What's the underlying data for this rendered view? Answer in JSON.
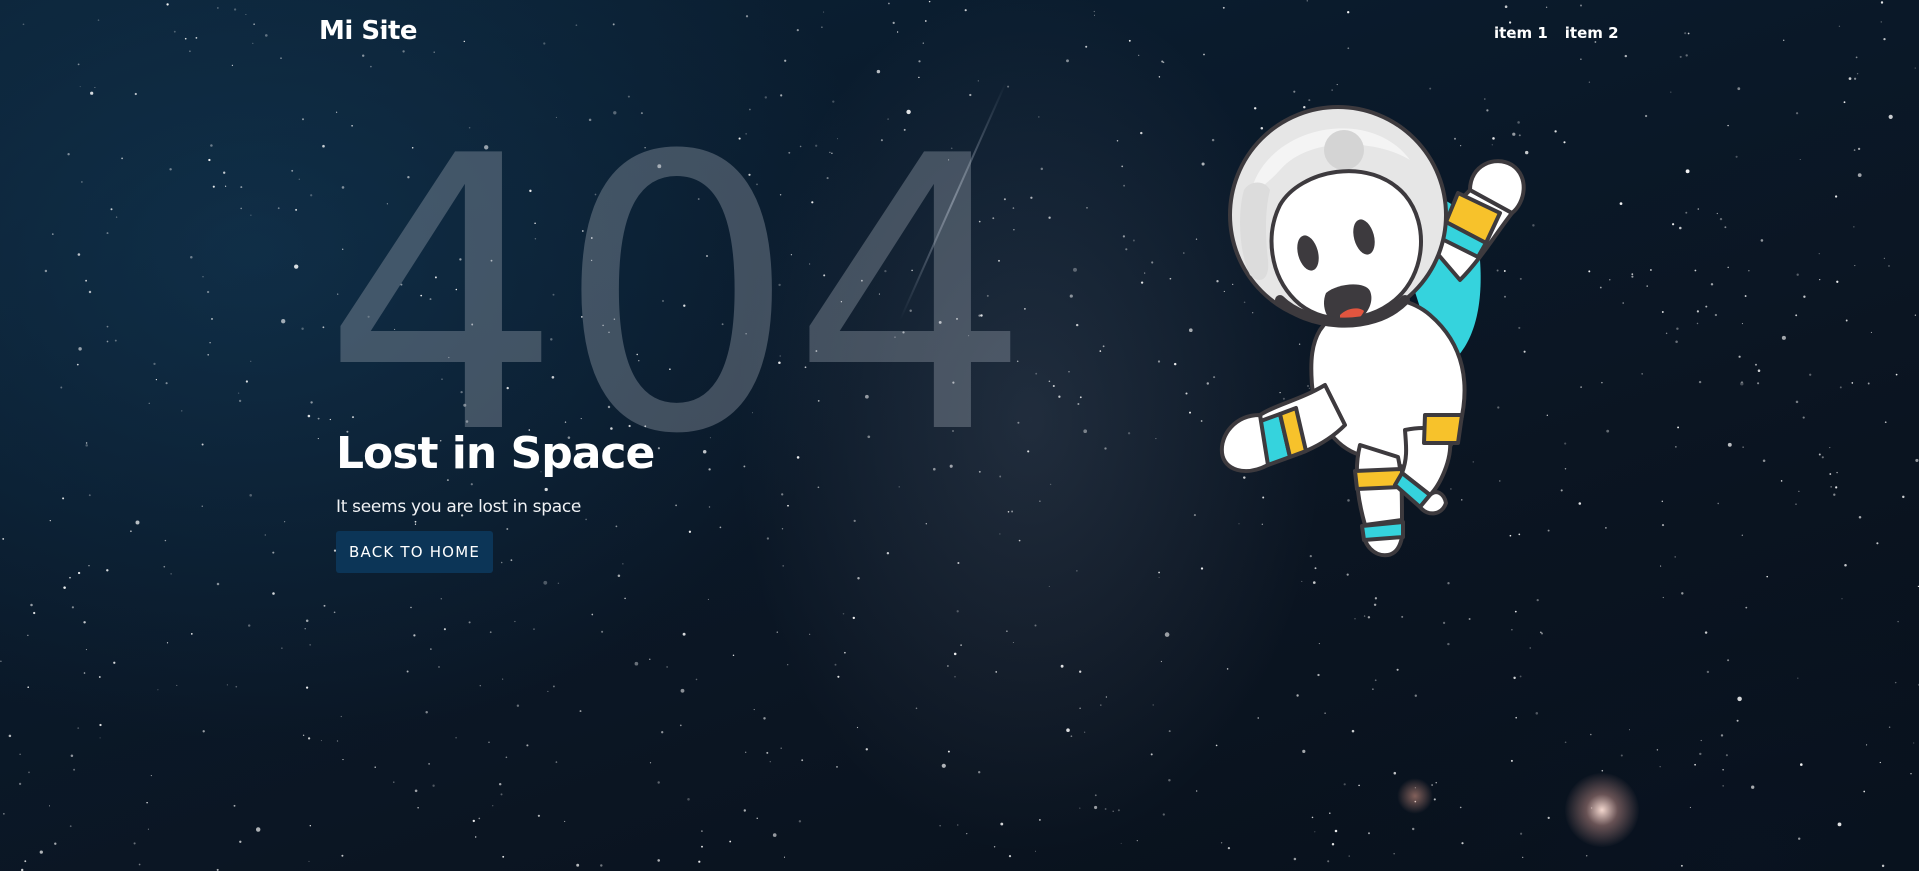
{
  "header": {
    "brand": "Mi Site",
    "nav": [
      {
        "label": "item 1"
      },
      {
        "label": "item 2"
      }
    ]
  },
  "hero": {
    "code": "404",
    "title": "Lost in Space",
    "subtitle": "It seems you are lost in space",
    "button_label": "BACK TO HOME",
    "illustration": "astronaut-illustration"
  },
  "colors": {
    "background": "#0b1a2a",
    "button": "#0c3557",
    "code_text": "#a0aab4",
    "astronaut_cyan": "#35d3dd",
    "astronaut_yellow": "#f7c22b"
  }
}
